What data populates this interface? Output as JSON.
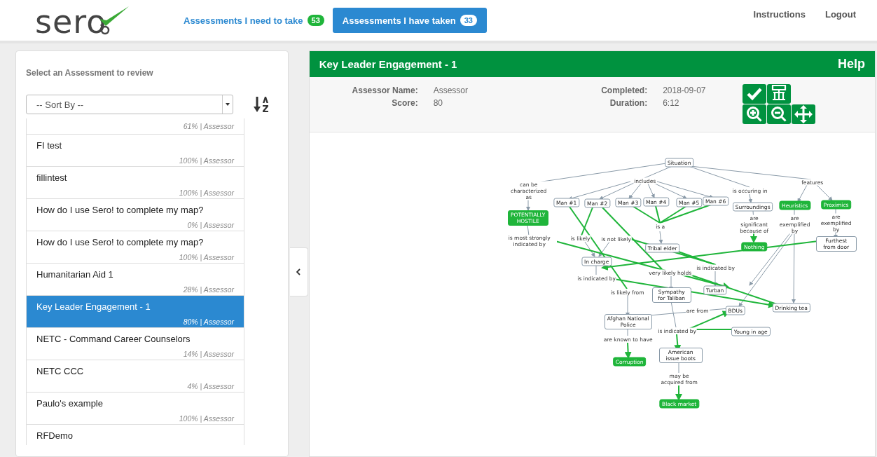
{
  "header": {
    "logo": "sero",
    "nav": [
      {
        "label": "Assessments I need to take",
        "count": "53",
        "selected": false
      },
      {
        "label": "Assessments I have taken",
        "count": "33",
        "selected": true
      }
    ],
    "links": [
      "Instructions",
      "Logout"
    ]
  },
  "sidebar": {
    "title": "Select an Assessment to review",
    "sort": {
      "placeholder": "-- Sort By --"
    },
    "items": [
      {
        "meta": "61% | Assessor",
        "selected": false
      },
      {
        "name": "FI test",
        "meta": "100% | Assessor",
        "selected": false
      },
      {
        "name": "fillintest",
        "meta": "100% | Assessor",
        "selected": false
      },
      {
        "name": "How do I use Sero! to complete my map?",
        "meta": "0% | Assessor",
        "selected": false
      },
      {
        "name": "How do I use Sero! to complete my map?",
        "meta": "100% | Assessor",
        "selected": false
      },
      {
        "name": "Humanitarian Aid 1",
        "meta": "28% | Assessor",
        "selected": false
      },
      {
        "name": "Key Leader Engagement - 1",
        "meta": "80% | Assessor",
        "selected": true
      },
      {
        "name": "NETC - Command Career Counselors",
        "meta": "14% | Assessor",
        "selected": false
      },
      {
        "name": "NETC CCC",
        "meta": "4% | Assessor",
        "selected": false
      },
      {
        "name": "Paulo's example",
        "meta": "100% | Assessor",
        "selected": false
      },
      {
        "name": "RFDemo",
        "selected": false
      }
    ]
  },
  "detail": {
    "title": "Key Leader Engagement - 1",
    "help": "Help",
    "fields": [
      {
        "label": "Assessor Name:",
        "value": "Assessor"
      },
      {
        "label": "Score:",
        "value": "80"
      },
      {
        "label": "Completed:",
        "value": "2018-09-07"
      },
      {
        "label": "Duration:",
        "value": "6:12"
      }
    ],
    "concept_map": {
      "nodes": [
        {
          "text": "Situation",
          "kind": "concept"
        },
        {
          "text": "includes",
          "kind": "phrase"
        },
        {
          "text": "features",
          "kind": "phrase"
        },
        {
          "text": "can be characterized as",
          "kind": "phrase"
        },
        {
          "text": "is occuring in",
          "kind": "phrase"
        },
        {
          "text": "Man #1",
          "kind": "concept"
        },
        {
          "text": "Man #2",
          "kind": "concept"
        },
        {
          "text": "Man #3",
          "kind": "concept"
        },
        {
          "text": "Man #4",
          "kind": "concept"
        },
        {
          "text": "Man #5",
          "kind": "concept"
        },
        {
          "text": "Man #6",
          "kind": "concept"
        },
        {
          "text": "Surroundings",
          "kind": "concept"
        },
        {
          "text": "Heuristics",
          "kind": "highlight"
        },
        {
          "text": "Proximics",
          "kind": "highlight"
        },
        {
          "text": "POTENTIALLY HOSTILE",
          "kind": "highlight"
        },
        {
          "text": "is a",
          "kind": "phrase"
        },
        {
          "text": "are significant because of",
          "kind": "phrase"
        },
        {
          "text": "are exemplified by",
          "kind": "phrase"
        },
        {
          "text": "are exemplified by",
          "kind": "phrase"
        },
        {
          "text": "is most strongly indicated by",
          "kind": "phrase"
        },
        {
          "text": "is likely",
          "kind": "phrase"
        },
        {
          "text": "is not likely",
          "kind": "phrase"
        },
        {
          "text": "Tribal elder",
          "kind": "concept"
        },
        {
          "text": "Nothing",
          "kind": "highlight"
        },
        {
          "text": "Furthest from door",
          "kind": "concept"
        },
        {
          "text": "In charge",
          "kind": "concept"
        },
        {
          "text": "very likely holds",
          "kind": "phrase"
        },
        {
          "text": "is indicated by",
          "kind": "phrase"
        },
        {
          "text": "is indicated by",
          "kind": "phrase"
        },
        {
          "text": "is likely from",
          "kind": "phrase"
        },
        {
          "text": "Sympathy for Taliban",
          "kind": "concept"
        },
        {
          "text": "Turban",
          "kind": "concept"
        },
        {
          "text": "are from",
          "kind": "phrase"
        },
        {
          "text": "BDUs",
          "kind": "concept"
        },
        {
          "text": "Drinking tea",
          "kind": "concept"
        },
        {
          "text": "Afghan National Police",
          "kind": "concept"
        },
        {
          "text": "is indicated by",
          "kind": "phrase"
        },
        {
          "text": "Young in age",
          "kind": "concept"
        },
        {
          "text": "are known to have",
          "kind": "phrase"
        },
        {
          "text": "Corruption",
          "kind": "highlight"
        },
        {
          "text": "American issue boots",
          "kind": "concept"
        },
        {
          "text": "may be acquired from",
          "kind": "phrase"
        },
        {
          "text": "Black market",
          "kind": "highlight"
        }
      ]
    }
  }
}
